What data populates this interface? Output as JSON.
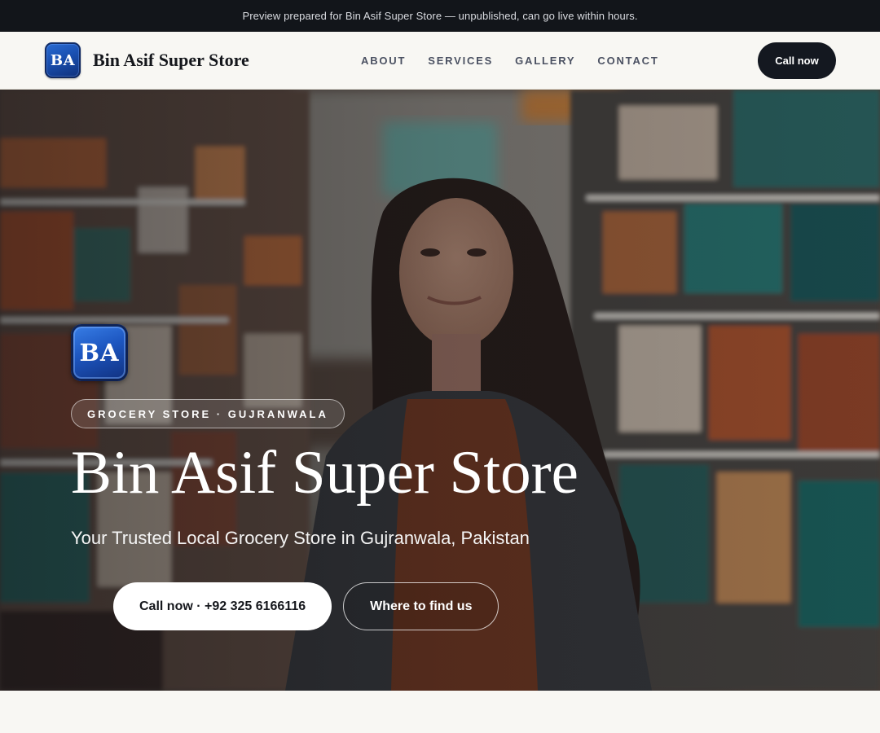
{
  "banner": {
    "text": "Preview prepared for Bin Asif Super Store — unpublished, can go live within hours."
  },
  "header": {
    "logo_text": "BA",
    "brand_name": "Bin Asif Super Store",
    "nav": [
      {
        "label": "ABOUT"
      },
      {
        "label": "SERVICES"
      },
      {
        "label": "GALLERY"
      },
      {
        "label": "CONTACT"
      }
    ],
    "call_button": "Call now"
  },
  "hero": {
    "logo_text": "BA",
    "chip": "GROCERY STORE · GUJRANWALA",
    "title": "Bin Asif Super Store",
    "subtitle": "Your Trusted Local Grocery Store in Gujranwala, Pakistan",
    "primary_button": "Call now · +92 325 6166116",
    "secondary_button": "Where to find us"
  },
  "colors": {
    "banner_bg": "#12151a",
    "header_bg": "#f8f7f3",
    "call_button_bg": "#141820",
    "logo_blue": "#1a4fb0"
  },
  "icons": {
    "hero_image": "grocery-aisle-photo"
  }
}
